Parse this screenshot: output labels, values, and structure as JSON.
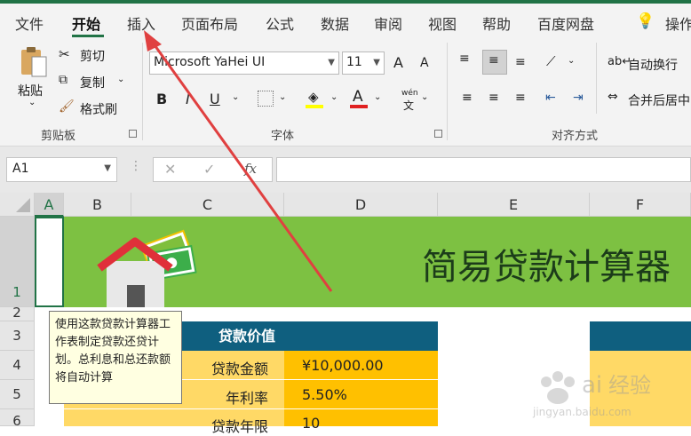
{
  "menu": {
    "tabs": [
      "文件",
      "开始",
      "插入",
      "页面布局",
      "公式",
      "数据",
      "审阅",
      "视图",
      "帮助",
      "百度网盘"
    ],
    "active_tab": "开始",
    "tell_me": "操作"
  },
  "ribbon": {
    "clipboard": {
      "paste": "粘贴",
      "cut": "剪切",
      "copy": "复制",
      "format_painter": "格式刷",
      "label": "剪贴板"
    },
    "font": {
      "name": "Microsoft YaHei UI",
      "size": "11",
      "bold": "B",
      "italic": "I",
      "underline": "U",
      "font_color_glyph": "A",
      "phonetic": "wén",
      "label": "字体",
      "grow": "A",
      "shrink": "A"
    },
    "alignment": {
      "wrap_text": "自动换行",
      "merge_center": "合并后居中",
      "label": "对齐方式"
    }
  },
  "formula_bar": {
    "name_box": "A1",
    "fx": "fx",
    "value": ""
  },
  "grid": {
    "columns": [
      "A",
      "B",
      "C",
      "D",
      "E",
      "F"
    ],
    "rows": [
      "1",
      "2",
      "3",
      "4",
      "5",
      "6"
    ],
    "banner_title": "简易贷款计算器",
    "section_header": "贷款价值",
    "labels": [
      "贷款金额",
      "年利率",
      "贷款年限"
    ],
    "values": [
      "¥10,000.00",
      "5.50%",
      "10"
    ],
    "comment": "使用这款贷款计算器工作表制定贷款还贷计划。总利息和总还款额将自动计算"
  },
  "colors": {
    "excel_green": "#217346",
    "banner_green": "#7dc142",
    "header_blue": "#0f5f7f",
    "value_gold": "#ffc000",
    "label_gold": "#ffd966",
    "arrow_red": "#e04040"
  },
  "watermark": "Baidu经验 jingyan.baidu.com"
}
